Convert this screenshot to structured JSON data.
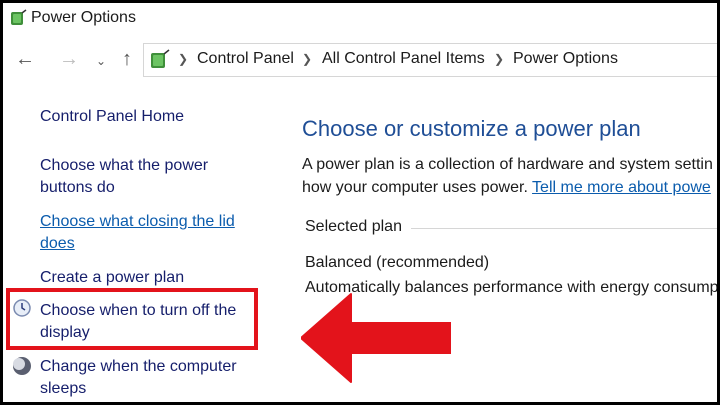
{
  "window": {
    "title": "Power Options"
  },
  "address": {
    "breadcrumbs": [
      "Control Panel",
      "All Control Panel Items",
      "Power Options"
    ]
  },
  "sidebar": {
    "home": "Control Panel Home",
    "items": [
      {
        "label_line1": "Choose what the power",
        "label_line2": "buttons do"
      },
      {
        "label_line1": "Choose what closing the lid",
        "label_line2": "does"
      },
      {
        "label_line1": "Create a power plan"
      },
      {
        "label_line1": "Choose when to turn off the",
        "label_line2": "display"
      },
      {
        "label_line1": "Change when the computer",
        "label_line2": "sleeps"
      }
    ]
  },
  "main": {
    "title": "Choose or customize a power plan",
    "desc_line1": "A power plan is a collection of hardware and system settin",
    "desc_line2_prefix": "how your computer uses power.",
    "desc_link": "Tell me more about powe",
    "section_label": "Selected plan",
    "plan_name": "Balanced (recommended)",
    "plan_desc": "Automatically balances performance with energy consump"
  },
  "colors": {
    "highlight": "#e3131b",
    "link": "#0b5cad",
    "title": "#1f4e96"
  }
}
